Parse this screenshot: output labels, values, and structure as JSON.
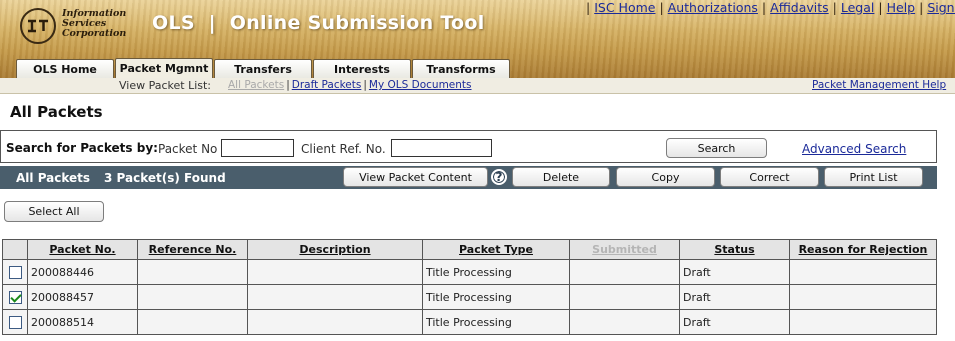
{
  "header": {
    "logo_lines": [
      "Information",
      "Services",
      "Corporation"
    ],
    "logo_mark": "ISC",
    "app_title": "OLS  |  Online Submission Tool",
    "top_links": [
      "ISC Home",
      "Authorizations",
      "Affidavits",
      "Legal",
      "Help",
      "Sign Out"
    ]
  },
  "tabs": [
    {
      "label": "OLS Home"
    },
    {
      "label": "Packet Mgmnt"
    },
    {
      "label": "Transfers"
    },
    {
      "label": "Interests"
    },
    {
      "label": "Transforms"
    }
  ],
  "subnav": {
    "label": "View Packet List:",
    "links": [
      "All Packets",
      "Draft Packets",
      "My OLS Documents"
    ],
    "right_link": "Packet Management Help"
  },
  "page_title": "All Packets",
  "search": {
    "title": "Search for Packets by:",
    "packet_no_label": "Packet No",
    "packet_no_value": "",
    "client_ref_label": "Client Ref. No.",
    "client_ref_value": "",
    "search_button": "Search",
    "advanced_link": "Advanced Search"
  },
  "results_bar": {
    "title": "All Packets",
    "count_text": "3 Packet(s) Found",
    "buttons": {
      "view": "View Packet Content",
      "delete": "Delete",
      "copy": "Copy",
      "correct": "Correct",
      "print": "Print List"
    },
    "help_icon": "?"
  },
  "select_all": "Select All",
  "table": {
    "columns": [
      "Packet No.",
      "Reference No.",
      "Description",
      "Packet Type",
      "Submitted",
      "Status",
      "Reason for Rejection"
    ],
    "rows": [
      {
        "checked": false,
        "packet_no": "200088446",
        "reference": "",
        "description": "",
        "type": "Title Processing",
        "submitted": "",
        "status": "Draft",
        "reason": ""
      },
      {
        "checked": true,
        "packet_no": "200088457",
        "reference": "",
        "description": "",
        "type": "Title Processing",
        "submitted": "",
        "status": "Draft",
        "reason": ""
      },
      {
        "checked": false,
        "packet_no": "200088514",
        "reference": "",
        "description": "",
        "type": "Title Processing",
        "submitted": "",
        "status": "Draft",
        "reason": ""
      }
    ]
  },
  "colors": {
    "results_bar": "#4a5e6c",
    "link": "#1b2a99",
    "header_wheat": "#c49a4a"
  }
}
